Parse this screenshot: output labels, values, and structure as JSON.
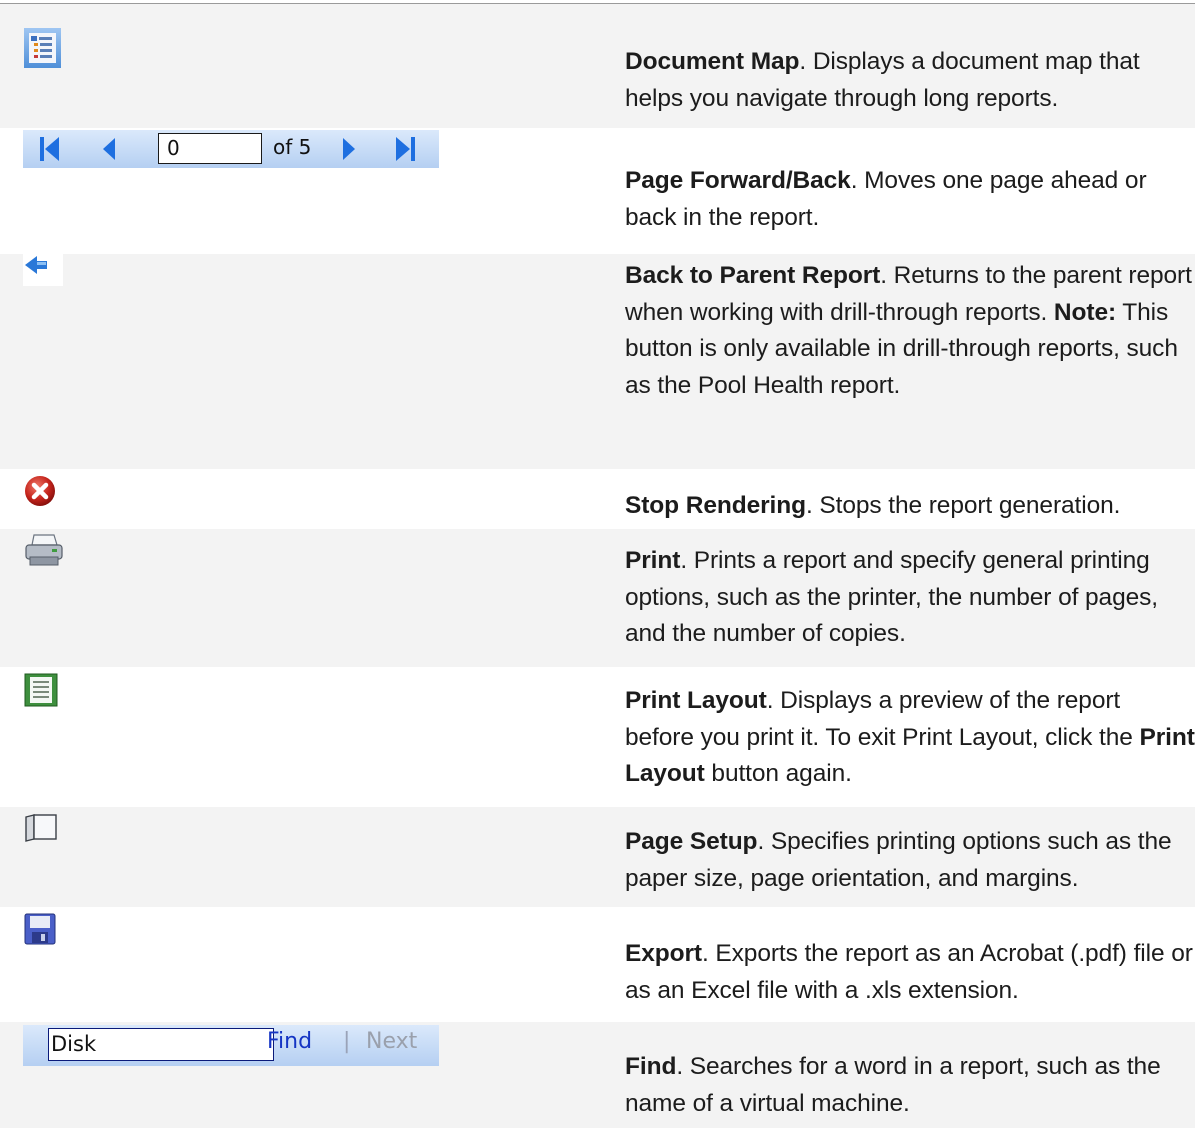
{
  "rows": [
    {
      "icon": "document-map-icon",
      "title": "Document Map",
      "text": ". Displays a document map that helps you navigate through long reports."
    },
    {
      "icon": "page-navigation-toolbar",
      "title": "Page Forward/Back",
      "text": ". Moves one page ahead or back in the report.",
      "toolbar": {
        "page_value": "0",
        "of_label": "of 5"
      }
    },
    {
      "icon": "back-arrow-icon",
      "title": "Back to Parent Report",
      "text": ". Returns to the parent report when working with drill-through reports. ",
      "note_label": "Note:",
      "note_text": " This button is only available in drill-through reports, such as the Pool Health report."
    },
    {
      "icon": "stop-icon",
      "title": "Stop Rendering",
      "text": ". Stops the report generation."
    },
    {
      "icon": "printer-icon",
      "title": "Print",
      "text": ". Prints a report and specify general printing options, such as the printer, the number of pages, and the number of copies."
    },
    {
      "icon": "print-layout-icon",
      "title": "Print Layout",
      "text": ". Displays a preview of the report before you print it. To exit Print Layout, click the ",
      "inline_bold": "Print Layout",
      "tail": " button again."
    },
    {
      "icon": "page-setup-icon",
      "title": "Page Setup",
      "text": ". Specifies printing options such as the paper size, page orientation, and margins."
    },
    {
      "icon": "save-disk-icon",
      "title": "Export",
      "text": ". Exports the report as an Acrobat (.pdf) file or as an Excel file with a .xls extension."
    },
    {
      "icon": "find-toolbar",
      "title": "Find",
      "text": ". Searches for a word in a report, such as the name of a virtual machine.",
      "toolbar": {
        "search_value": "Disk",
        "find_label": "Find",
        "separator": "|",
        "next_label": "Next"
      }
    }
  ]
}
